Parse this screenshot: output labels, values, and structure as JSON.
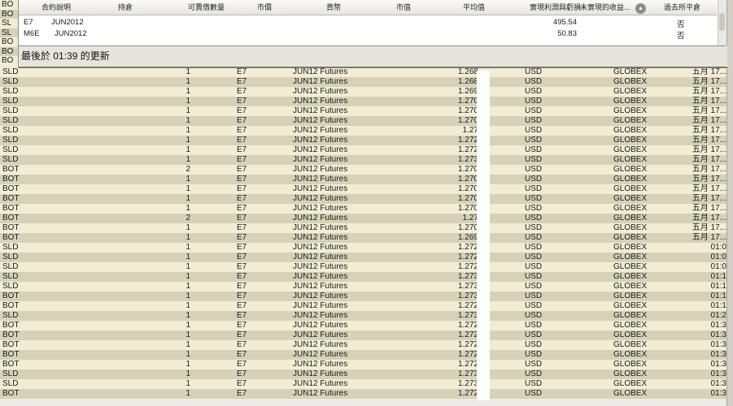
{
  "left_peek": [
    "BO",
    "BO",
    "SL",
    "SL",
    "BO",
    "BO",
    "BO"
  ],
  "portfolio": {
    "headers": {
      "contract": "合約說明",
      "position": "持倉",
      "available": "可賣借數量",
      "market_price": "市價",
      "currency": "貨幣",
      "market_value": "市值",
      "avg_price": "平均值",
      "realized_pnl": "實現利潤與虧損",
      "unrealized_pnl": "未實現的收益...",
      "closed": "過去所平倉"
    },
    "sort_icon": "triangle-up-icon",
    "rows": [
      {
        "symbol": "E7",
        "expiry": "JUN2012",
        "realized_pnl": "495.54",
        "closed": "否"
      },
      {
        "symbol": "M6E",
        "expiry": "JUN2012",
        "realized_pnl": "50.83",
        "closed": "否"
      }
    ]
  },
  "status": {
    "text": "最後於 01:39 的更新"
  },
  "trades": [
    {
      "action": "SLD",
      "qty": "1",
      "symbol": "E7",
      "desc": "JUN12 Futures",
      "price": "1.268",
      "currency": "USD",
      "exchange": "GLOBEX",
      "time": "五月 17..."
    },
    {
      "action": "SLD",
      "qty": "1",
      "symbol": "E7",
      "desc": "JUN12 Futures",
      "price": "1.268",
      "currency": "USD",
      "exchange": "GLOBEX",
      "time": "五月 17..."
    },
    {
      "action": "SLD",
      "qty": "1",
      "symbol": "E7",
      "desc": "JUN12 Futures",
      "price": "1.269",
      "currency": "USD",
      "exchange": "GLOBEX",
      "time": "五月 17..."
    },
    {
      "action": "SLD",
      "qty": "1",
      "symbol": "E7",
      "desc": "JUN12 Futures",
      "price": "1.270",
      "currency": "USD",
      "exchange": "GLOBEX",
      "time": "五月 17..."
    },
    {
      "action": "SLD",
      "qty": "1",
      "symbol": "E7",
      "desc": "JUN12 Futures",
      "price": "1.270",
      "currency": "USD",
      "exchange": "GLOBEX",
      "time": "五月 17..."
    },
    {
      "action": "SLD",
      "qty": "1",
      "symbol": "E7",
      "desc": "JUN12 Futures",
      "price": "1.270",
      "currency": "USD",
      "exchange": "GLOBEX",
      "time": "五月 17..."
    },
    {
      "action": "SLD",
      "qty": "1",
      "symbol": "E7",
      "desc": "JUN12 Futures",
      "price": "1.27",
      "currency": "USD",
      "exchange": "GLOBEX",
      "time": "五月 17..."
    },
    {
      "action": "SLD",
      "qty": "1",
      "symbol": "E7",
      "desc": "JUN12 Futures",
      "price": "1.272",
      "currency": "USD",
      "exchange": "GLOBEX",
      "time": "五月 17..."
    },
    {
      "action": "SLD",
      "qty": "1",
      "symbol": "E7",
      "desc": "JUN12 Futures",
      "price": "1.272",
      "currency": "USD",
      "exchange": "GLOBEX",
      "time": "五月 17..."
    },
    {
      "action": "SLD",
      "qty": "1",
      "symbol": "E7",
      "desc": "JUN12 Futures",
      "price": "1.273",
      "currency": "USD",
      "exchange": "GLOBEX",
      "time": "五月 17..."
    },
    {
      "action": "BOT",
      "qty": "2",
      "symbol": "E7",
      "desc": "JUN12 Futures",
      "price": "1.270",
      "currency": "USD",
      "exchange": "GLOBEX",
      "time": "五月 17..."
    },
    {
      "action": "BOT",
      "qty": "1",
      "symbol": "E7",
      "desc": "JUN12 Futures",
      "price": "1.270",
      "currency": "USD",
      "exchange": "GLOBEX",
      "time": "五月 17..."
    },
    {
      "action": "BOT",
      "qty": "1",
      "symbol": "E7",
      "desc": "JUN12 Futures",
      "price": "1.270",
      "currency": "USD",
      "exchange": "GLOBEX",
      "time": "五月 17..."
    },
    {
      "action": "BOT",
      "qty": "1",
      "symbol": "E7",
      "desc": "JUN12 Futures",
      "price": "1.270",
      "currency": "USD",
      "exchange": "GLOBEX",
      "time": "五月 17..."
    },
    {
      "action": "BOT",
      "qty": "1",
      "symbol": "E7",
      "desc": "JUN12 Futures",
      "price": "1.270",
      "currency": "USD",
      "exchange": "GLOBEX",
      "time": "五月 17..."
    },
    {
      "action": "BOT",
      "qty": "2",
      "symbol": "E7",
      "desc": "JUN12 Futures",
      "price": "1.27",
      "currency": "USD",
      "exchange": "GLOBEX",
      "time": "五月 17..."
    },
    {
      "action": "BOT",
      "qty": "1",
      "symbol": "E7",
      "desc": "JUN12 Futures",
      "price": "1.270",
      "currency": "USD",
      "exchange": "GLOBEX",
      "time": "五月 17..."
    },
    {
      "action": "BOT",
      "qty": "1",
      "symbol": "E7",
      "desc": "JUN12 Futures",
      "price": "1.269",
      "currency": "USD",
      "exchange": "GLOBEX",
      "time": "五月 17..."
    },
    {
      "action": "SLD",
      "qty": "1",
      "symbol": "E7",
      "desc": "JUN12 Futures",
      "price": "1.272",
      "currency": "USD",
      "exchange": "GLOBEX",
      "time": "01:0"
    },
    {
      "action": "SLD",
      "qty": "1",
      "symbol": "E7",
      "desc": "JUN12 Futures",
      "price": "1.272",
      "currency": "USD",
      "exchange": "GLOBEX",
      "time": "01:0"
    },
    {
      "action": "SLD",
      "qty": "1",
      "symbol": "E7",
      "desc": "JUN12 Futures",
      "price": "1.272",
      "currency": "USD",
      "exchange": "GLOBEX",
      "time": "01:0"
    },
    {
      "action": "SLD",
      "qty": "1",
      "symbol": "E7",
      "desc": "JUN12 Futures",
      "price": "1.273",
      "currency": "USD",
      "exchange": "GLOBEX",
      "time": "01:1"
    },
    {
      "action": "SLD",
      "qty": "1",
      "symbol": "E7",
      "desc": "JUN12 Futures",
      "price": "1.273",
      "currency": "USD",
      "exchange": "GLOBEX",
      "time": "01:1"
    },
    {
      "action": "BOT",
      "qty": "1",
      "symbol": "E7",
      "desc": "JUN12 Futures",
      "price": "1.273",
      "currency": "USD",
      "exchange": "GLOBEX",
      "time": "01:1"
    },
    {
      "action": "BOT",
      "qty": "1",
      "symbol": "E7",
      "desc": "JUN12 Futures",
      "price": "1.272",
      "currency": "USD",
      "exchange": "GLOBEX",
      "time": "01:1"
    },
    {
      "action": "SLD",
      "qty": "1",
      "symbol": "E7",
      "desc": "JUN12 Futures",
      "price": "1.273",
      "currency": "USD",
      "exchange": "GLOBEX",
      "time": "01:2"
    },
    {
      "action": "BOT",
      "qty": "1",
      "symbol": "E7",
      "desc": "JUN12 Futures",
      "price": "1.272",
      "currency": "USD",
      "exchange": "GLOBEX",
      "time": "01:3"
    },
    {
      "action": "BOT",
      "qty": "1",
      "symbol": "E7",
      "desc": "JUN12 Futures",
      "price": "1.272",
      "currency": "USD",
      "exchange": "GLOBEX",
      "time": "01:3"
    },
    {
      "action": "BOT",
      "qty": "1",
      "symbol": "E7",
      "desc": "JUN12 Futures",
      "price": "1.272",
      "currency": "USD",
      "exchange": "GLOBEX",
      "time": "01:3"
    },
    {
      "action": "BOT",
      "qty": "1",
      "symbol": "E7",
      "desc": "JUN12 Futures",
      "price": "1.272",
      "currency": "USD",
      "exchange": "GLOBEX",
      "time": "01:3"
    },
    {
      "action": "BOT",
      "qty": "1",
      "symbol": "E7",
      "desc": "JUN12 Futures",
      "price": "1.272",
      "currency": "USD",
      "exchange": "GLOBEX",
      "time": "01:3"
    },
    {
      "action": "SLD",
      "qty": "1",
      "symbol": "E7",
      "desc": "JUN12 Futures",
      "price": "1.273",
      "currency": "USD",
      "exchange": "GLOBEX",
      "time": "01:3"
    },
    {
      "action": "SLD",
      "qty": "1",
      "symbol": "E7",
      "desc": "JUN12 Futures",
      "price": "1.273",
      "currency": "USD",
      "exchange": "GLOBEX",
      "time": "01:3"
    },
    {
      "action": "BOT",
      "qty": "1",
      "symbol": "E7",
      "desc": "JUN12 Futures",
      "price": "1.272",
      "currency": "USD",
      "exchange": "GLOBEX",
      "time": "01:3"
    }
  ]
}
